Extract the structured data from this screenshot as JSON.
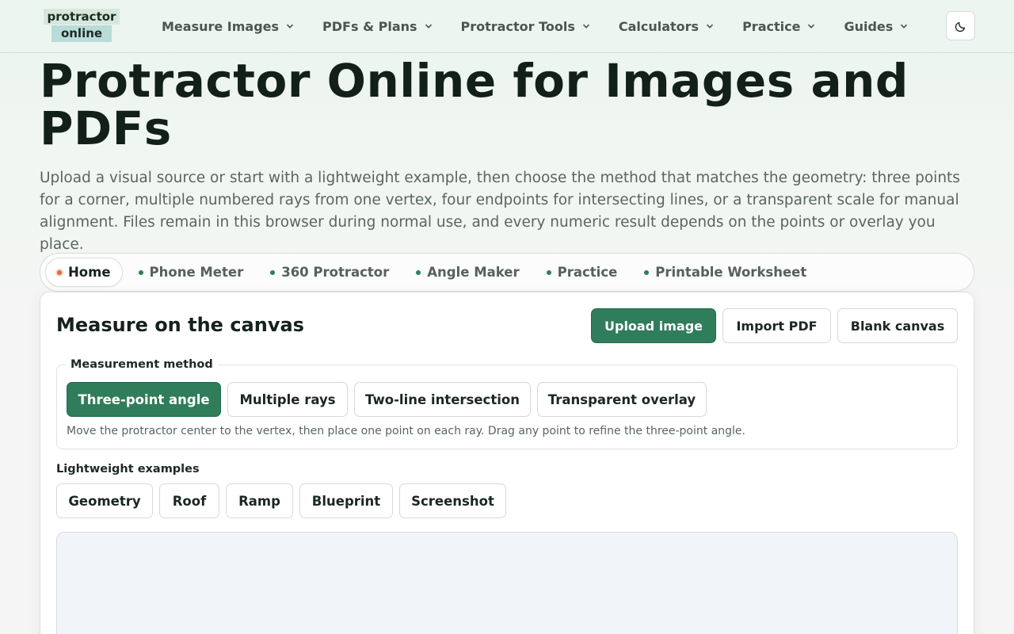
{
  "header": {
    "logo_line1": "protractor",
    "logo_line2": "online",
    "nav": [
      {
        "label": "Measure Images"
      },
      {
        "label": "PDFs & Plans"
      },
      {
        "label": "Protractor Tools"
      },
      {
        "label": "Calculators"
      },
      {
        "label": "Practice"
      },
      {
        "label": "Guides"
      }
    ],
    "theme_icon": "moon-icon"
  },
  "hero": {
    "title": "Protractor Online for Images and PDFs",
    "lead": "Upload a visual source or start with a lightweight example, then choose the method that matches the geometry: three points for a corner, multiple numbered rays from one vertex, four endpoints for intersecting lines, or a transparent scale for manual alignment. Files remain in this browser during normal use, and every numeric result depends on the points or overlay you place."
  },
  "tabs": [
    {
      "label": "Home",
      "active": true
    },
    {
      "label": "Phone Meter"
    },
    {
      "label": "360 Protractor"
    },
    {
      "label": "Angle Maker"
    },
    {
      "label": "Practice"
    },
    {
      "label": "Printable Worksheet"
    }
  ],
  "workspace": {
    "title": "Measure on the canvas",
    "upload_label": "Upload image",
    "import_label": "Import PDF",
    "blank_label": "Blank canvas",
    "method_legend": "Measurement method",
    "methods": [
      {
        "label": "Three-point angle",
        "active": true
      },
      {
        "label": "Multiple rays"
      },
      {
        "label": "Two-line intersection"
      },
      {
        "label": "Transparent overlay"
      }
    ],
    "hint": "Move the protractor center to the vertex, then place one point on each ray. Drag any point to refine the three-point angle.",
    "examples_label": "Lightweight examples",
    "examples": [
      "Geometry",
      "Roof",
      "Ramp",
      "Blueprint",
      "Screenshot"
    ]
  },
  "colors": {
    "accent": "#2f7d5a",
    "active_dot": "#e06b3d"
  }
}
